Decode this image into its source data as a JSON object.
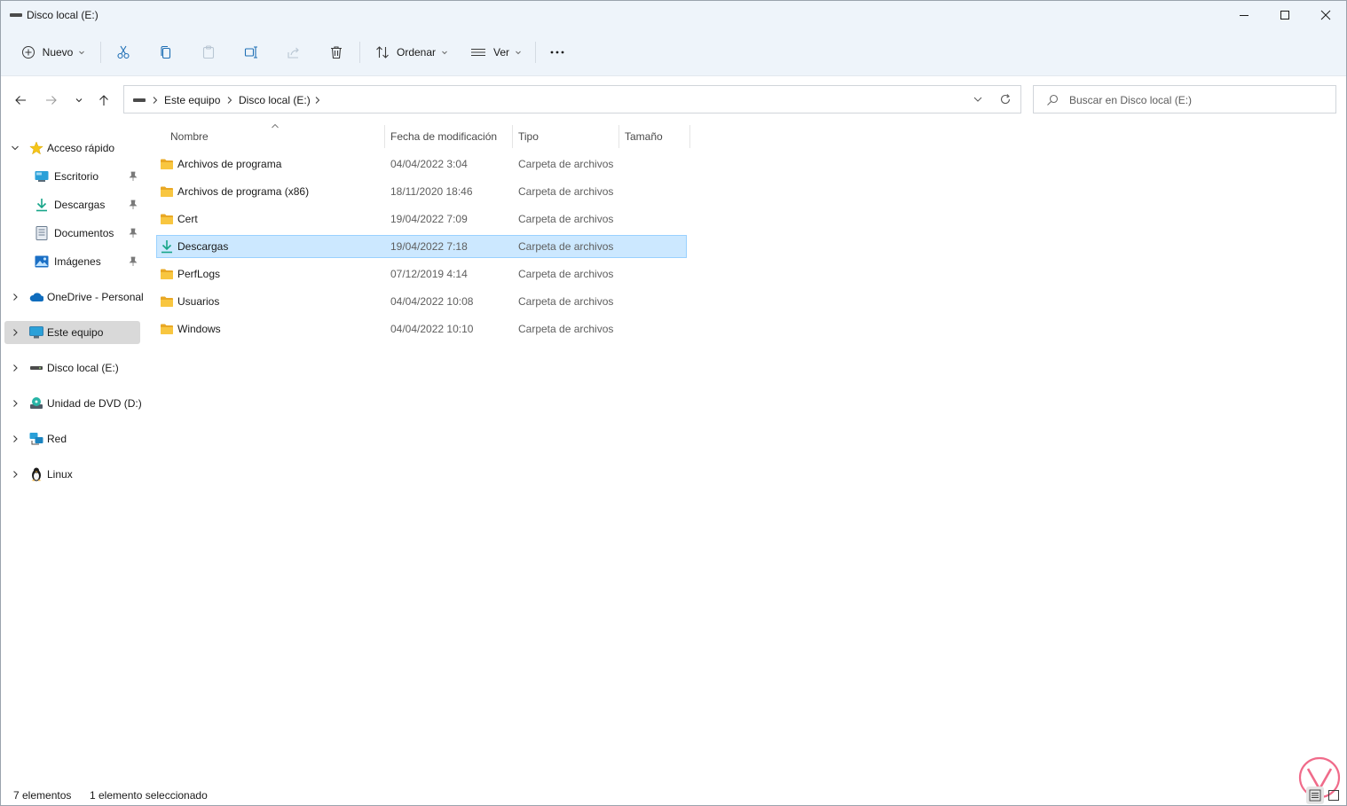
{
  "window": {
    "title": "Disco local (E:)"
  },
  "toolbar": {
    "new_label": "Nuevo",
    "sort_label": "Ordenar",
    "view_label": "Ver"
  },
  "address": {
    "crumbs": [
      "Este equipo",
      "Disco local (E:)"
    ]
  },
  "search": {
    "placeholder": "Buscar en Disco local (E:)"
  },
  "sidebar": {
    "quick_access": "Acceso rápido",
    "pinned": [
      "Escritorio",
      "Descargas",
      "Documentos",
      "Imágenes"
    ],
    "onedrive": "OneDrive - Personal",
    "this_pc": "Este equipo",
    "local_disk": "Disco local (E:)",
    "dvd": "Unidad de DVD (D:)",
    "network": "Red",
    "linux": "Linux"
  },
  "columns": {
    "name": "Nombre",
    "date": "Fecha de modificación",
    "type": "Tipo",
    "size": "Tamaño"
  },
  "files": [
    {
      "name": "Archivos de programa",
      "date": "04/04/2022 3:04",
      "type": "Carpeta de archivos"
    },
    {
      "name": "Archivos de programa (x86)",
      "date": "18/11/2020 18:46",
      "type": "Carpeta de archivos"
    },
    {
      "name": "Cert",
      "date": "19/04/2022 7:09",
      "type": "Carpeta de archivos"
    },
    {
      "name": "Descargas",
      "date": "19/04/2022 7:18",
      "type": "Carpeta de archivos"
    },
    {
      "name": "PerfLogs",
      "date": "07/12/2019 4:14",
      "type": "Carpeta de archivos"
    },
    {
      "name": "Usuarios",
      "date": "04/04/2022 10:08",
      "type": "Carpeta de archivos"
    },
    {
      "name": "Windows",
      "date": "04/04/2022 10:10",
      "type": "Carpeta de archivos"
    }
  ],
  "status": {
    "count": "7 elementos",
    "selection": "1 elemento seleccionado"
  },
  "colors": {
    "chrome_bg": "#eef4fa",
    "selection_bg": "#cce8ff",
    "selection_border": "#99d1ff",
    "folder_yellow": "#f8c640",
    "download_green": "#17a589"
  }
}
